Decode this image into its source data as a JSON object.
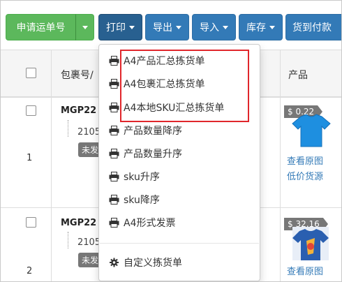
{
  "toolbar": {
    "apply_label": "申请运单号",
    "print_label": "打印",
    "export_label": "导出",
    "import_label": "导入",
    "stock_label": "库存",
    "cod_label": "货到付款"
  },
  "table": {
    "headers": {
      "package": "包裹号/",
      "product": "产品"
    },
    "rows": [
      {
        "num": "1",
        "package_no": "MGP22",
        "sub_no": "2105",
        "status": "未发",
        "price": "$ 0.22",
        "link1": "查看原图",
        "link2": "低价货源"
      },
      {
        "num": "2",
        "package_no": "MGP22",
        "sub_no": "2105",
        "status": "未发",
        "price": "$ 32.16",
        "link1": "查看原图",
        "link2": ""
      }
    ]
  },
  "print_menu": {
    "items": [
      {
        "label": "A4产品汇总拣货单",
        "icon": "printer-icon"
      },
      {
        "label": "A4包裹汇总拣货单",
        "icon": "printer-icon"
      },
      {
        "label": "A4本地SKU汇总拣货单",
        "icon": "printer-icon"
      },
      {
        "label": "产品数量降序",
        "icon": "printer-icon"
      },
      {
        "label": "产品数量升序",
        "icon": "printer-icon"
      },
      {
        "label": "sku升序",
        "icon": "printer-icon"
      },
      {
        "label": "sku降序",
        "icon": "printer-icon"
      },
      {
        "label": "A4形式发票",
        "icon": "printer-icon"
      }
    ],
    "custom": {
      "label": "自定义拣货单",
      "icon": "gear-icon"
    }
  },
  "colors": {
    "green": "#5cb85c",
    "blue": "#337ab7",
    "blue_active": "#286090",
    "highlight": "#e0262b",
    "link": "#337ab7"
  }
}
